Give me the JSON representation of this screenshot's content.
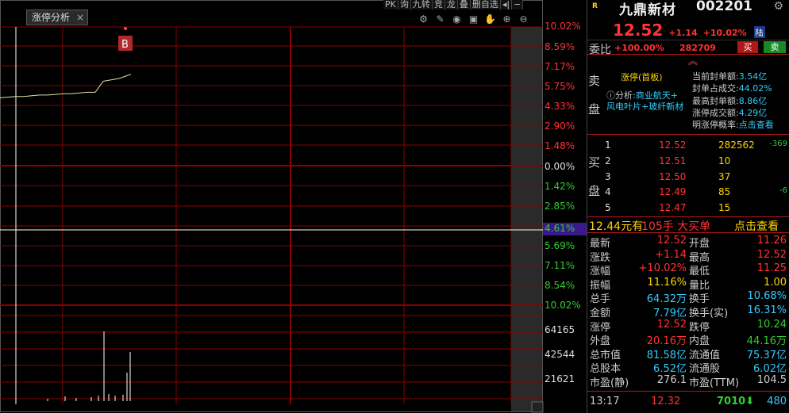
{
  "chart": {
    "tab_label": "涨停分析",
    "tab_close": "×",
    "top_buttons": [
      "PK",
      "询",
      "九转",
      "竞",
      "龙",
      "叠",
      "删自选",
      "◂|",
      "−"
    ],
    "marker_label": "B",
    "price_axis_labels": [
      "10.02%",
      "8.59%",
      "7.17%",
      "5.75%",
      "4.33%",
      "2.90%",
      "1.48%",
      "0.00%",
      "1.42%",
      "2.85%",
      "4.61%",
      "5.69%",
      "7.11%",
      "8.54%",
      "10.02%"
    ],
    "volume_axis_labels": [
      "64165",
      "42544",
      "21621"
    ],
    "colors": {
      "grid": "#8b0000",
      "price_line": "#e0e0a0",
      "avg_line": "#ffffff",
      "highlight": "#3a1a8a"
    }
  },
  "chart_data": {
    "type": "line",
    "title": "",
    "xlabel": "",
    "ylabel": "",
    "x": [
      0,
      10,
      20,
      30,
      40,
      50,
      60,
      70,
      80,
      90,
      100,
      110,
      120,
      130,
      140,
      150,
      160,
      165
    ],
    "series": [
      {
        "values": [
          4.9,
          4.95,
          5.0,
          5.0,
          5.05,
          5.1,
          5.1,
          5.15,
          5.2,
          5.2,
          5.25,
          5.3,
          5.3,
          6.1,
          6.2,
          6.3,
          6.5,
          6.6
        ]
      }
    ],
    "ylim": [
      -10.02,
      10.02
    ]
  },
  "stock": {
    "mark": "R",
    "name": "九鼎新材",
    "code": "002201",
    "price": "12.52",
    "change": "+1.14",
    "change_pct": "+10.02%",
    "market_tag": "陆"
  },
  "weibi": {
    "label": "委比",
    "pct": "+100.00%",
    "diff": "282709",
    "buy": "买",
    "sell": "卖"
  },
  "sell_panel": {
    "side_label_1": "卖",
    "side_label_2": "盘",
    "zt_title": "涨停(首板)",
    "analysis_prefix": "ⓘ分析:",
    "analysis_1": "商业航天+",
    "analysis_2": "风电叶片+玻纤新材",
    "stats": [
      {
        "k": "当前封单额:",
        "v": "3.54亿"
      },
      {
        "k": "封单占成交:",
        "v": "44.02%"
      },
      {
        "k": "最高封单额:",
        "v": "8.86亿"
      },
      {
        "k": "涨停成交额:",
        "v": "4.29亿"
      },
      {
        "k": "明涨停概率:",
        "v": "点击查看"
      }
    ]
  },
  "buy_book": {
    "side_label_1": "买",
    "side_label_2": "盘",
    "rows": [
      {
        "n": "1",
        "p": "12.52",
        "q": "282562",
        "c": "-369"
      },
      {
        "n": "2",
        "p": "12.51",
        "q": "10",
        "c": ""
      },
      {
        "n": "3",
        "p": "12.50",
        "q": "37",
        "c": ""
      },
      {
        "n": "4",
        "p": "12.49",
        "q": "85",
        "c": "-6"
      },
      {
        "n": "5",
        "p": "12.47",
        "q": "15",
        "c": ""
      }
    ]
  },
  "big_order": {
    "a": "12.44元有",
    "b": "105手 大买单",
    "c": "点击查看"
  },
  "quote": [
    {
      "l1": "最新",
      "v1": "12.52",
      "c1": "#ff3333",
      "l2": "开盘",
      "v2": "11.26",
      "c2": "#ff3333"
    },
    {
      "l1": "涨跌",
      "v1": "+1.14",
      "c1": "#ff3333",
      "l2": "最高",
      "v2": "12.52",
      "c2": "#ff3333"
    },
    {
      "l1": "涨幅",
      "v1": "+10.02%",
      "c1": "#ff3333",
      "l2": "最低",
      "v2": "11.25",
      "c2": "#ff3333"
    },
    {
      "l1": "振幅",
      "v1": "11.16%",
      "c1": "#ffd400",
      "l2": "量比",
      "v2": "1.00",
      "c2": "#ffd400"
    },
    {
      "l1": "总手",
      "v1": "64.32万",
      "c1": "#33ccff",
      "l2": "换手",
      "v2": "10.68%",
      "c2": "#33ccff"
    },
    {
      "l1": "金额",
      "v1": "7.79亿",
      "c1": "#33ccff",
      "l2": "换手(实)",
      "v2": "16.31%",
      "c2": "#33ccff"
    },
    {
      "l1": "涨停",
      "v1": "12.52",
      "c1": "#ff3333",
      "l2": "跌停",
      "v2": "10.24",
      "c2": "#33cc33"
    },
    {
      "l1": "外盘",
      "v1": "20.16万",
      "c1": "#ff3333",
      "l2": "内盘",
      "v2": "44.16万",
      "c2": "#33cc33"
    },
    {
      "l1": "总市值",
      "v1": "81.58亿",
      "c1": "#33ccff",
      "l2": "流通值",
      "v2": "75.37亿",
      "c2": "#33ccff"
    },
    {
      "l1": "总股本",
      "v1": "6.52亿",
      "c1": "#33ccff",
      "l2": "流通股",
      "v2": "6.02亿",
      "c2": "#33ccff"
    },
    {
      "l1": "市盈(静)",
      "v1": "276.1",
      "c1": "#ccc",
      "l2": "市盈(TTM)",
      "v2": "104.5",
      "c2": "#ccc"
    }
  ],
  "footer": {
    "time": "13:17",
    "price": "12.32",
    "vol": "7010",
    "arrow": "⬇",
    "seq": "480"
  }
}
